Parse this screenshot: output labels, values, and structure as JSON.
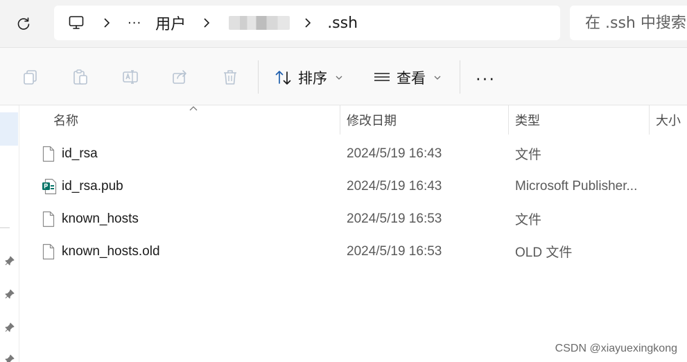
{
  "breadcrumb": {
    "ellipsis": "···",
    "items": [
      "用户",
      ".ssh"
    ],
    "separator": ">"
  },
  "search": {
    "placeholder": "在 .ssh 中搜索"
  },
  "command_bar": {
    "sort_label": "排序",
    "view_label": "查看",
    "more_label": "···"
  },
  "columns": {
    "name": "名称",
    "date_modified": "修改日期",
    "type": "类型",
    "size": "大小"
  },
  "files": [
    {
      "name": "id_rsa",
      "date": "2024/5/19 16:43",
      "type": "文件",
      "icon": "file-icon"
    },
    {
      "name": "id_rsa.pub",
      "date": "2024/5/19 16:43",
      "type": "Microsoft Publisher...",
      "icon": "publisher-file-icon"
    },
    {
      "name": "known_hosts",
      "date": "2024/5/19 16:53",
      "type": "文件",
      "icon": "file-icon"
    },
    {
      "name": "known_hosts.old",
      "date": "2024/5/19 16:53",
      "type": "OLD 文件",
      "icon": "file-icon"
    }
  ],
  "watermark": "CSDN @xiayuexingkong",
  "colors": {
    "publisher_icon": "#077568",
    "nav_selected": "#e6effa"
  }
}
